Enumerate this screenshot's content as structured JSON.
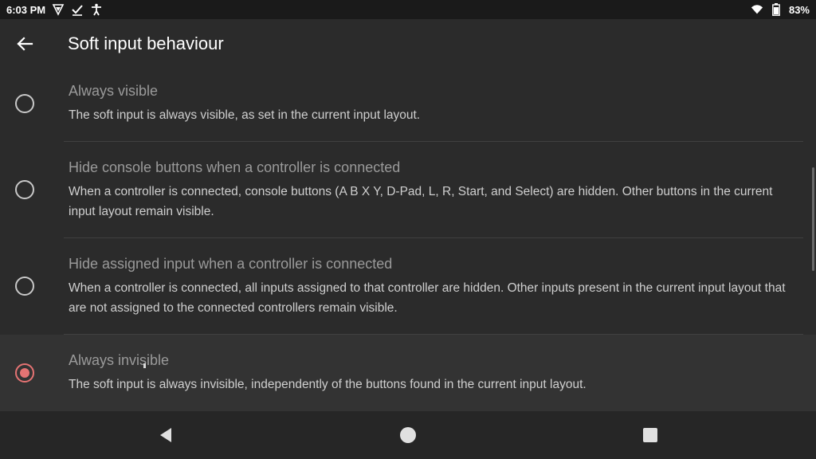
{
  "status_bar": {
    "time": "6:03 PM",
    "left_icons": [
      "vpn-shield-icon",
      "check-download-icon",
      "accessibility-icon"
    ],
    "right_icons": [
      "wifi-icon",
      "battery-icon"
    ],
    "battery_percent": "83%"
  },
  "app_bar": {
    "back_icon": "arrow-back-icon",
    "title": "Soft input behaviour"
  },
  "options": [
    {
      "title": "Always visible",
      "description": "The soft input is always visible, as set in the current input layout.",
      "selected": false
    },
    {
      "title": "Hide console buttons when a controller is connected",
      "description": "When a controller is connected, console buttons (A B X Y, D-Pad, L, R, Start, and Select) are hidden. Other buttons in the current input layout remain visible.",
      "selected": false
    },
    {
      "title": "Hide assigned input when a controller is connected",
      "description": "When a controller is connected, all inputs assigned to that controller are hidden. Other inputs present in the current input layout that are not assigned to the connected controllers remain visible.",
      "selected": false
    },
    {
      "title": "Always invisible",
      "description": "The soft input is always invisible, independently of the buttons found in the current input layout.",
      "selected": true
    }
  ],
  "colors": {
    "accent": "#e57373",
    "background": "#2b2b2b",
    "status_bar": "#1a1a1a",
    "nav_bar": "#262626"
  },
  "nav_bar": {
    "buttons": [
      "back-triangle-icon",
      "home-circle-icon",
      "recents-square-icon"
    ]
  }
}
